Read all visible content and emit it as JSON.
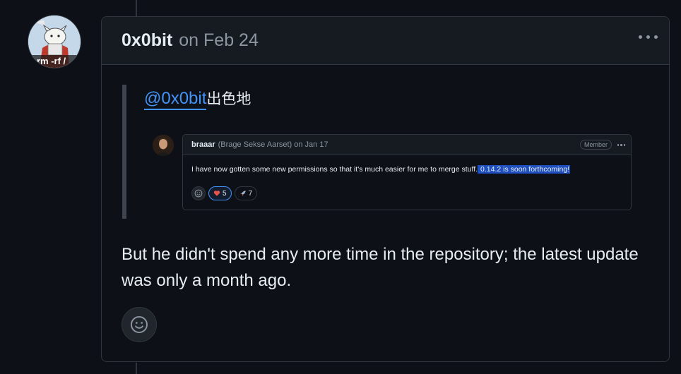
{
  "comment": {
    "author": "0x0bit",
    "date": "on Feb 24",
    "avatar_caption": "rm -rf /",
    "quote": {
      "mention": "@0x0bit",
      "mention_suffix": "出色地",
      "screenshot": {
        "author": "braaar",
        "author_meta": "(Brage Sekse Aarset) on Jan 17",
        "badge": "Member",
        "body": "I have now gotten some new permissions so that it's much easier for me to merge stuff.",
        "body_highlight": " 0.14.2 is soon forthcoming!",
        "reactions": [
          {
            "icon": "heart-icon",
            "count": "5"
          },
          {
            "icon": "rocket-icon",
            "count": "7"
          }
        ]
      }
    },
    "body": "But he didn't spend any more time in the repository; the latest update was only a month ago."
  },
  "colors": {
    "background": "#0d1117",
    "border": "#30363d",
    "link": "#4493f8",
    "muted": "#8d96a0",
    "text": "#e6edf3"
  }
}
